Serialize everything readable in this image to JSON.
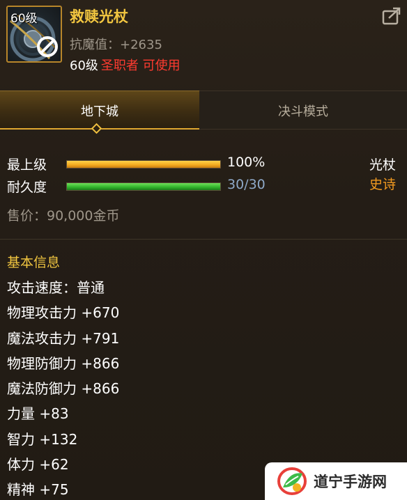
{
  "item": {
    "level_tag": "60级",
    "name": "救赎光杖",
    "attribute": "抗魔值：+2635",
    "req_level": "60级",
    "req_class": "圣职者 可使用",
    "icon": "staff-icon",
    "disabled_icon": "prohibited-icon",
    "share_icon": "share-icon"
  },
  "tabs": [
    {
      "label": "地下城",
      "active": true
    },
    {
      "label": "决斗模式",
      "active": false
    }
  ],
  "stats": {
    "grade_label": "最上级",
    "grade_value": "100%",
    "grade_fill": 1.0,
    "durability_label": "耐久度",
    "durability_value": "30/30",
    "durability_fill": 1.0,
    "weapon_type": "光杖",
    "rarity": "史诗",
    "price": "售价：90,000金币"
  },
  "basic_info": {
    "title": "基本信息",
    "items": [
      "攻击速度：普通",
      "物理攻击力 +670",
      "魔法攻击力 +791",
      "物理防御力 +866",
      "魔法防御力 +866",
      "力量 +83",
      "智力 +132",
      "体力 +62",
      "精神 +75"
    ]
  },
  "watermark": {
    "text": "道宁手游网",
    "logo": "leaf-logo-icon"
  },
  "colors": {
    "name": "#f2c640",
    "class_req": "#ff3b30",
    "rarity_epic": "#f29a20",
    "bar_gold": "#f2a81e",
    "bar_green": "#2fb22a"
  }
}
